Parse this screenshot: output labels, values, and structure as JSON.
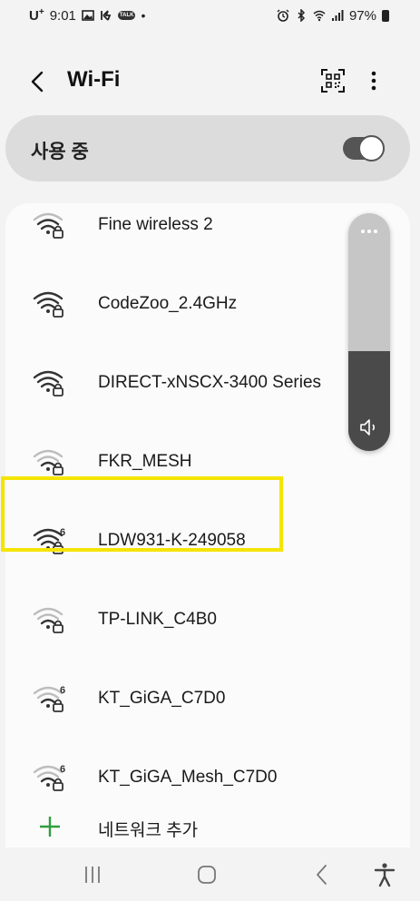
{
  "status_bar": {
    "carrier": "U",
    "carrier_sup": "+",
    "time": "9:01",
    "talk_badge": "TALK",
    "dot": "•",
    "battery_percent": "97%"
  },
  "header": {
    "title": "Wi-Fi"
  },
  "wifi_toggle": {
    "label": "사용 중",
    "on": true,
    "color_track": "#555555"
  },
  "networks": [
    {
      "name": "Fine wireless 2",
      "signal": 3,
      "locked": true,
      "wifi6": false,
      "partially_visible": true
    },
    {
      "name": "CodeZoo_2.4GHz",
      "signal": 4,
      "locked": true,
      "wifi6": false
    },
    {
      "name": "DIRECT-xNSCX-3400 Series",
      "signal": 4,
      "locked": true,
      "wifi6": false
    },
    {
      "name": "FKR_MESH",
      "signal": 2,
      "locked": true,
      "wifi6": false
    },
    {
      "name": "LDW931-K-249058",
      "signal": 4,
      "locked": true,
      "wifi6": true,
      "highlighted": true
    },
    {
      "name": "TP-LINK_C4B0",
      "signal": 2,
      "locked": true,
      "wifi6": false
    },
    {
      "name": "KT_GiGA_C7D0",
      "signal": 2,
      "locked": true,
      "wifi6": true
    },
    {
      "name": "KT_GiGA_Mesh_C7D0",
      "signal": 2,
      "locked": true,
      "wifi6": true
    }
  ],
  "add_network": {
    "label": "네트워크 추가",
    "icon": "plus-icon",
    "color": "#2e9e3e"
  },
  "volume": {
    "level": 0.42,
    "icon": "speaker-icon"
  },
  "highlight_color": "#f5e400",
  "nav": {
    "icons": [
      "recent-apps-icon",
      "home-icon",
      "back-icon",
      "accessibility-icon"
    ]
  }
}
